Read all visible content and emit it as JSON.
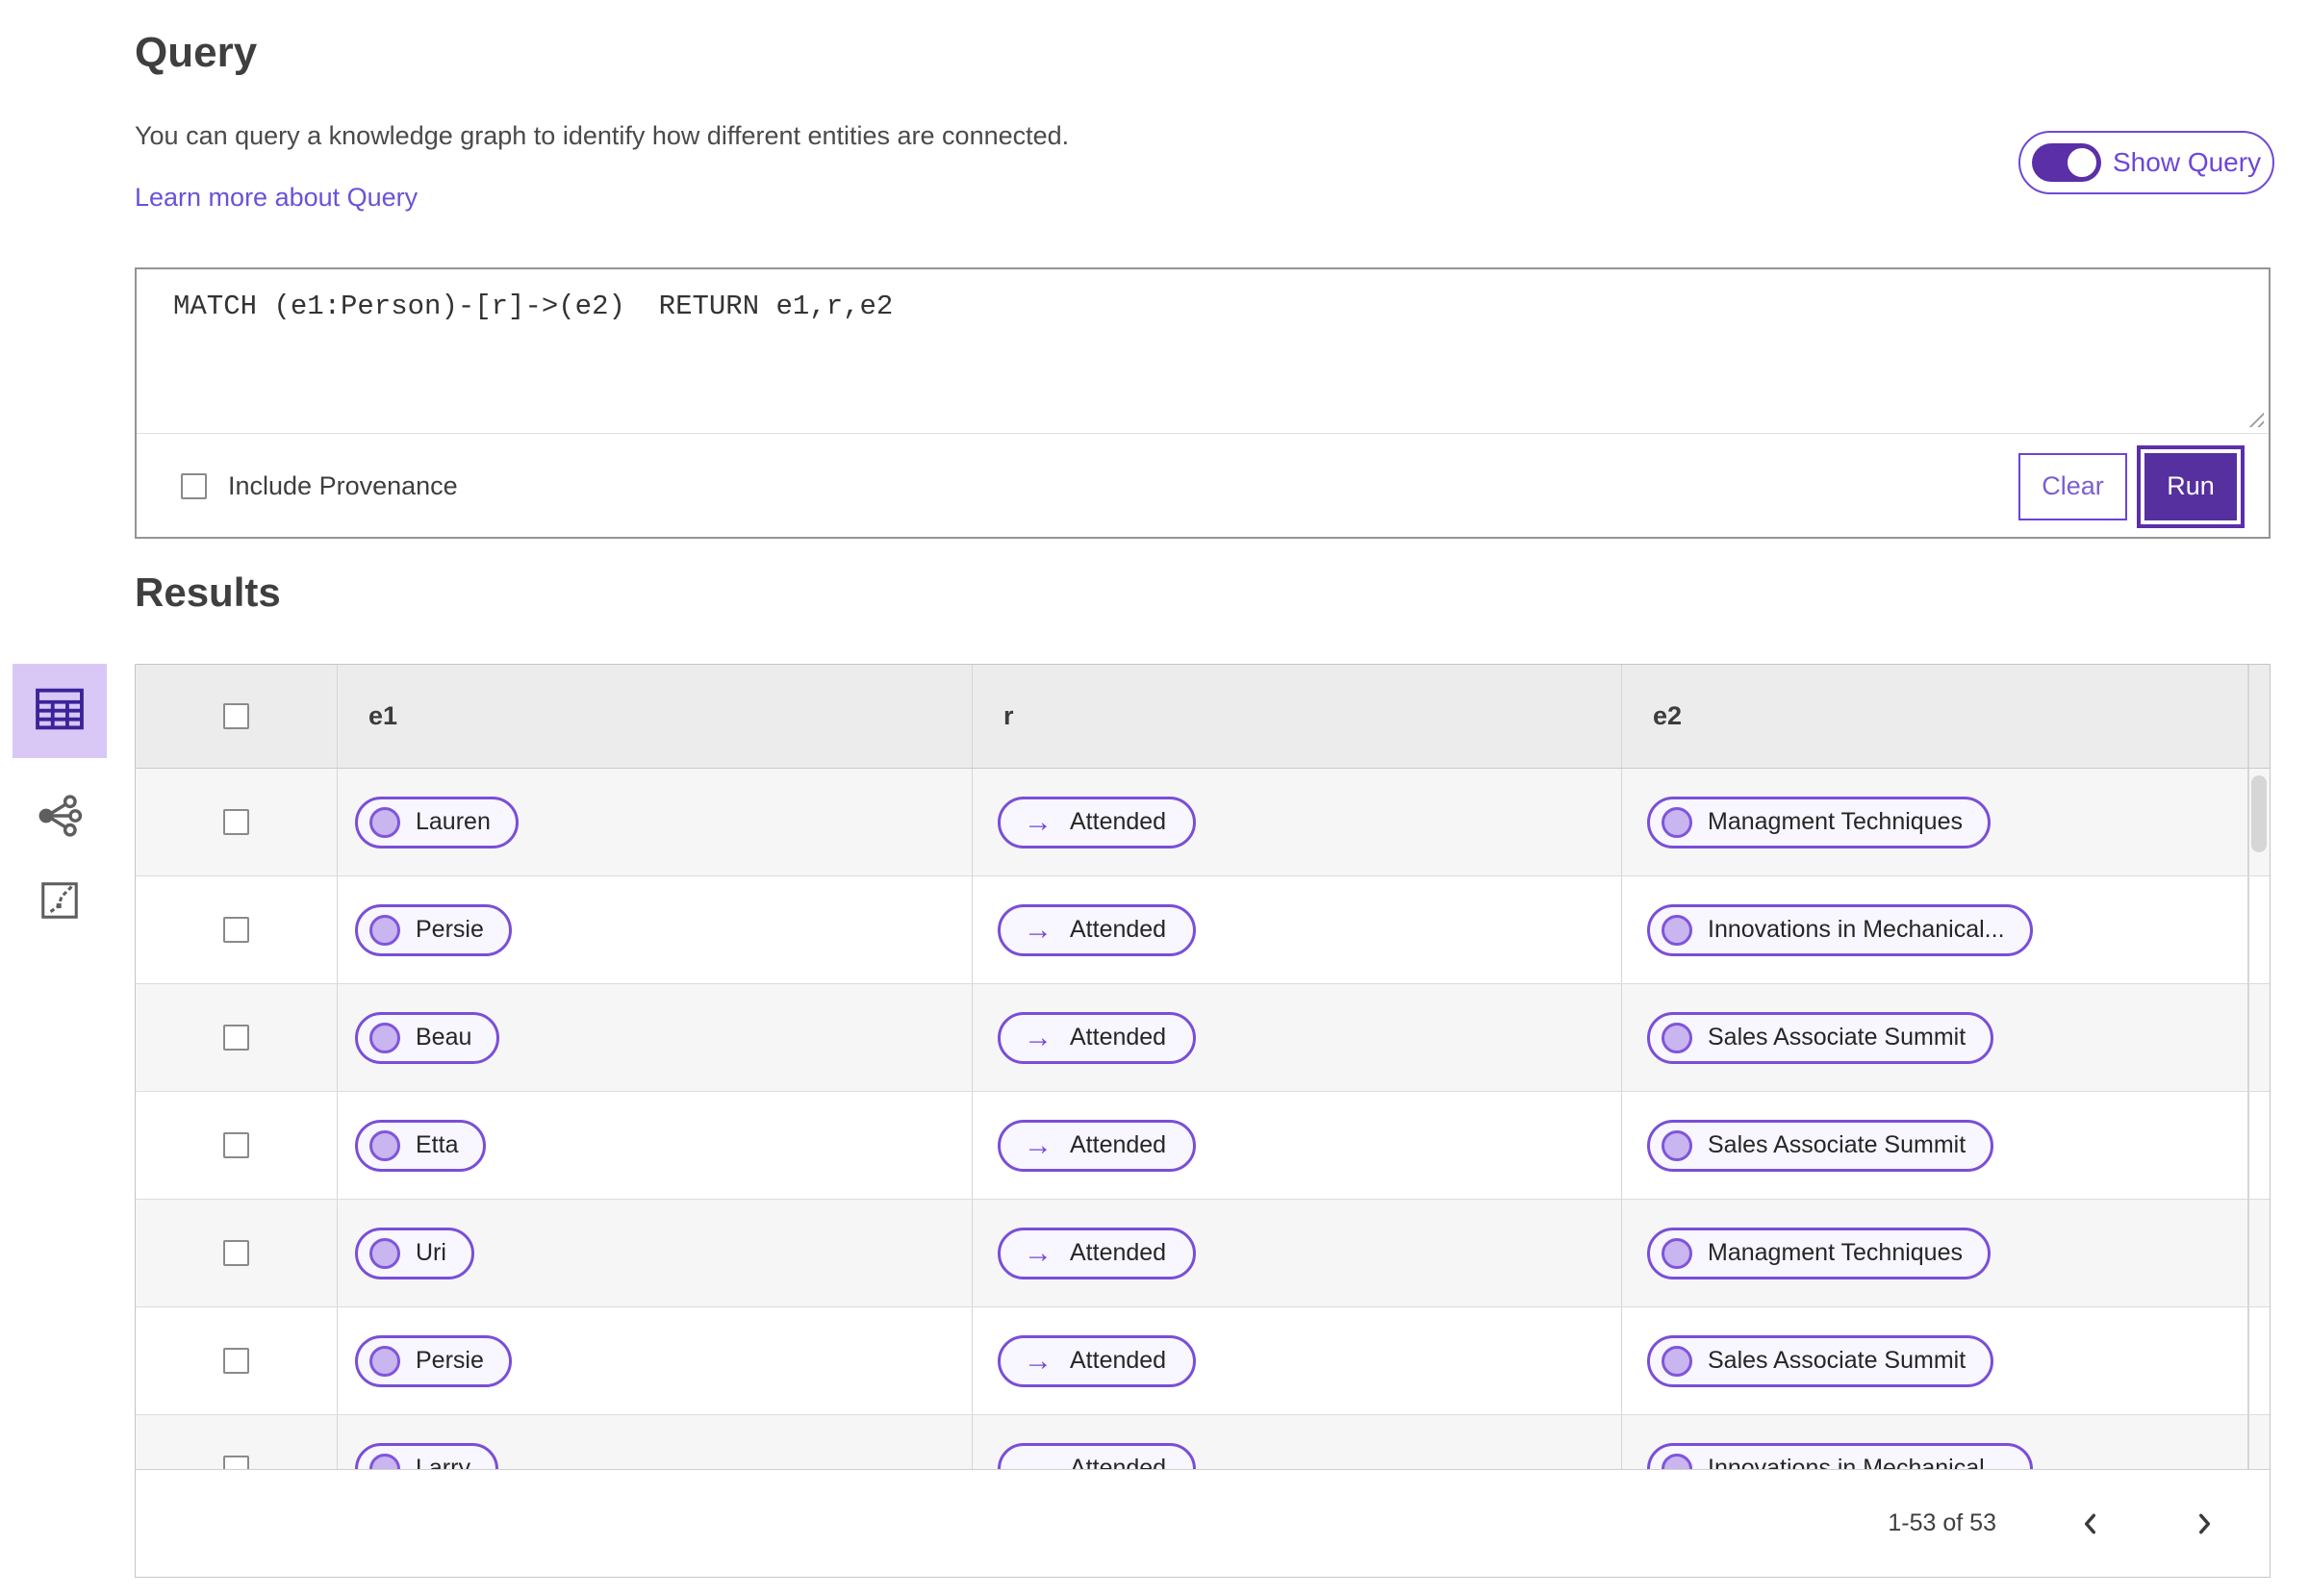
{
  "query_section": {
    "title": "Query",
    "description": "You can query a knowledge graph to identify how different entities are connected.",
    "learn_more_link": "Learn more about Query",
    "show_query_label": "Show Query",
    "show_query_state": "on",
    "query_text": "MATCH (e1:Person)-[r]->(e2)  RETURN e1,r,e2",
    "include_provenance_label": "Include Provenance",
    "include_provenance_checked": false,
    "clear_label": "Clear",
    "run_label": "Run"
  },
  "results_section": {
    "title": "Results",
    "views": [
      {
        "name": "table-view",
        "selected": true
      },
      {
        "name": "graph-view",
        "selected": false
      },
      {
        "name": "chart-view",
        "selected": false
      }
    ],
    "table": {
      "columns": [
        "e1",
        "r",
        "e2"
      ],
      "rows": [
        {
          "e1": "Lauren",
          "r": "Attended",
          "e2": "Managment Techniques"
        },
        {
          "e1": "Persie",
          "r": "Attended",
          "e2": "Innovations in Mechanical..."
        },
        {
          "e1": "Beau",
          "r": "Attended",
          "e2": "Sales Associate Summit"
        },
        {
          "e1": "Etta",
          "r": "Attended",
          "e2": "Sales Associate Summit"
        },
        {
          "e1": "Uri",
          "r": "Attended",
          "e2": "Managment Techniques"
        },
        {
          "e1": "Persie",
          "r": "Attended",
          "e2": "Sales Associate Summit"
        },
        {
          "e1": "Larry",
          "r": "Attended",
          "e2": "Innovations in Mechanical..."
        }
      ]
    },
    "pagination": {
      "range_label": "1-53 of 53"
    }
  },
  "colors": {
    "accent_purple": "#6f48d6",
    "deep_purple": "#56309f",
    "toggle_purple": "#5b2fa8",
    "link_purple": "#6a52d8",
    "pill_border": "#7a4ed8",
    "pill_bg": "#f8f6fe",
    "pill_dot_fill": "#c9b5ef",
    "selected_tile_bg": "#d9c8f6",
    "table_header_bg": "#ececec",
    "row_alt_bg": "#f6f6f6"
  }
}
